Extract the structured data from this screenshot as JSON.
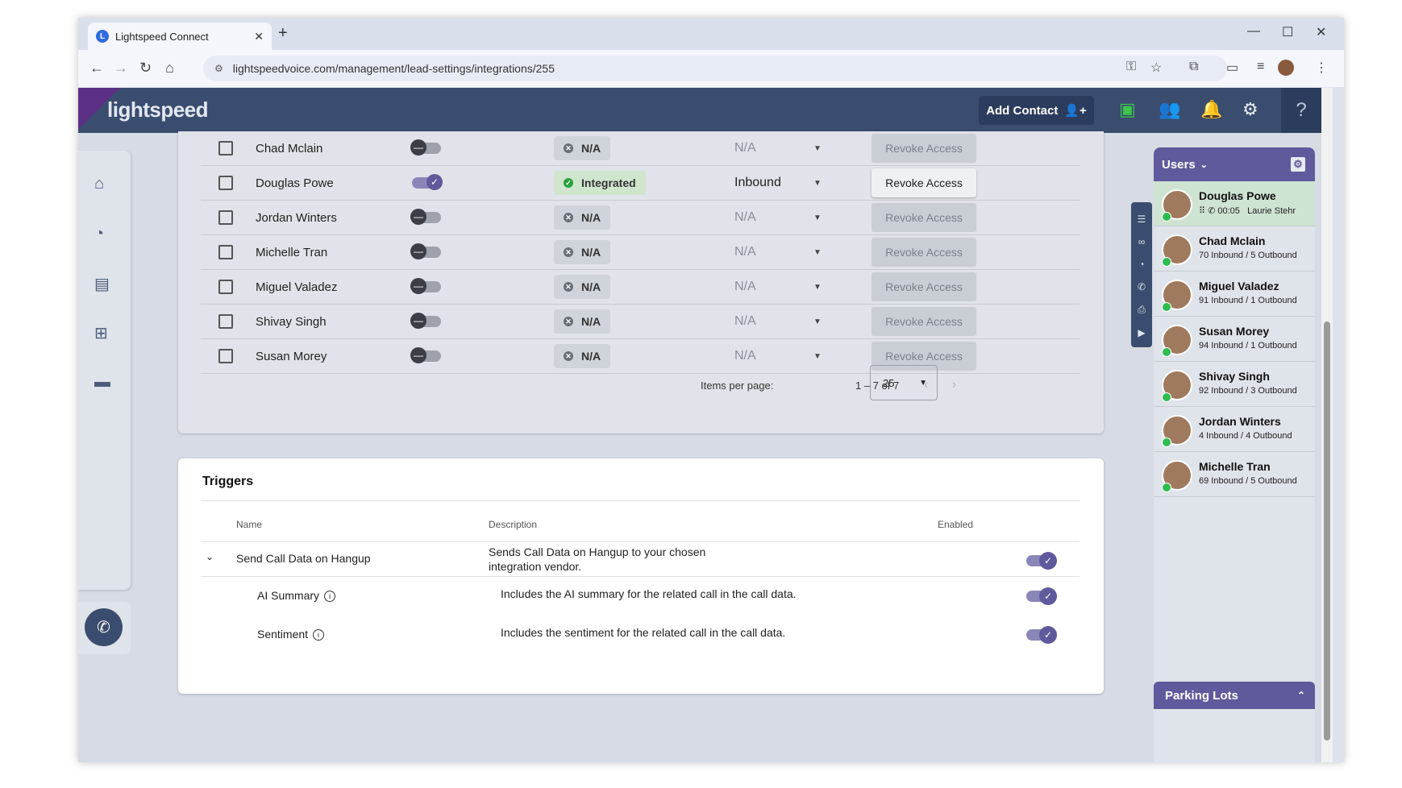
{
  "browser": {
    "tab_title": "Lightspeed Connect",
    "url": "lightspeedvoice.com/management/lead-settings/integrations/255"
  },
  "header": {
    "logo": "lightspeed",
    "add_contact_label": "Add Contact",
    "icons": [
      "phone-lock-icon",
      "users-icon",
      "bell-icon",
      "gear-icon",
      "help-bot-icon"
    ]
  },
  "users_table": {
    "rows": [
      {
        "name": "Chad Mclain",
        "enabled": false,
        "status": "N/A",
        "direction": "N/A",
        "action": "Revoke Access"
      },
      {
        "name": "Douglas Powe",
        "enabled": true,
        "status": "Integrated",
        "direction": "Inbound",
        "action": "Revoke Access"
      },
      {
        "name": "Jordan Winters",
        "enabled": false,
        "status": "N/A",
        "direction": "N/A",
        "action": "Revoke Access"
      },
      {
        "name": "Michelle Tran",
        "enabled": false,
        "status": "N/A",
        "direction": "N/A",
        "action": "Revoke Access"
      },
      {
        "name": "Miguel Valadez",
        "enabled": false,
        "status": "N/A",
        "direction": "N/A",
        "action": "Revoke Access"
      },
      {
        "name": "Shivay Singh",
        "enabled": false,
        "status": "N/A",
        "direction": "N/A",
        "action": "Revoke Access"
      },
      {
        "name": "Susan Morey",
        "enabled": false,
        "status": "N/A",
        "direction": "N/A",
        "action": "Revoke Access"
      }
    ],
    "pagination": {
      "items_per_page_label": "Items per page:",
      "items_per_page": "25",
      "range": "1 – 7 of 7"
    }
  },
  "triggers": {
    "title": "Triggers",
    "columns": {
      "name": "Name",
      "description": "Description",
      "enabled": "Enabled"
    },
    "main": {
      "name": "Send Call Data on Hangup",
      "description_line1": "Sends Call Data on Hangup to your chosen",
      "description_line2": "integration vendor.",
      "enabled": true
    },
    "sub": [
      {
        "name": "AI Summary",
        "description": "Includes the AI summary for the related call in the call data.",
        "enabled": true
      },
      {
        "name": "Sentiment",
        "description": "Includes the sentiment for the related call in the call data.",
        "enabled": true
      }
    ]
  },
  "users_panel": {
    "title": "Users",
    "users": [
      {
        "name": "Douglas Powe",
        "timer": "00:05",
        "with": "Laurie Stehr",
        "active": true
      },
      {
        "name": "Chad Mclain",
        "stats": "70 Inbound / 5 Outbound"
      },
      {
        "name": "Miguel Valadez",
        "stats": "91 Inbound / 1 Outbound"
      },
      {
        "name": "Susan Morey",
        "stats": "94 Inbound / 1 Outbound"
      },
      {
        "name": "Shivay Singh",
        "stats": "92 Inbound / 3 Outbound"
      },
      {
        "name": "Jordan Winters",
        "stats": "4 Inbound / 4 Outbound"
      },
      {
        "name": "Michelle Tran",
        "stats": "69 Inbound / 5 Outbound"
      }
    ]
  },
  "parking_lots": {
    "title": "Parking Lots"
  }
}
